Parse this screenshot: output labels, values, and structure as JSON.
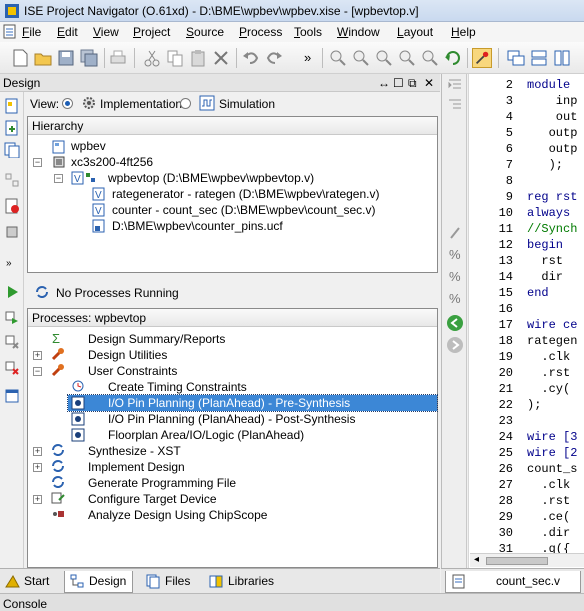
{
  "window": {
    "title": "ISE Project Navigator (O.61xd) - D:\\BME\\wpbev\\wpbev.xise - [wpbevtop.v]"
  },
  "menu": [
    {
      "label": "File",
      "u": "F"
    },
    {
      "label": "Edit",
      "u": "E"
    },
    {
      "label": "View",
      "u": "V"
    },
    {
      "label": "Project",
      "u": "P"
    },
    {
      "label": "Source",
      "u": "S"
    },
    {
      "label": "Process",
      "u": "P"
    },
    {
      "label": "Tools",
      "u": "T"
    },
    {
      "label": "Window",
      "u": "W"
    },
    {
      "label": "Layout",
      "u": "L"
    },
    {
      "label": "Help",
      "u": "H"
    }
  ],
  "design": {
    "panel_title": "Design",
    "view_label": "View:",
    "view_options": [
      "Implementation",
      "Simulation"
    ],
    "view_selected": "Implementation",
    "hierarchy_title": "Hierarchy",
    "hierarchy": [
      {
        "label": "wpbev"
      },
      {
        "label": "xc3s200-4ft256"
      },
      {
        "label": "wpbevtop (D:\\BME\\wpbev\\wpbevtop.v)"
      },
      {
        "label": "rategenerator - rategen (D:\\BME\\wpbev\\rategen.v)"
      },
      {
        "label": "counter - count_sec (D:\\BME\\wpbev\\count_sec.v)"
      },
      {
        "label": "D:\\BME\\wpbev\\counter_pins.ucf"
      }
    ],
    "process_status": "No Processes Running",
    "processes_title": "Processes: wpbevtop",
    "processes": [
      {
        "label": "Design Summary/Reports"
      },
      {
        "label": "Design Utilities"
      },
      {
        "label": "User Constraints"
      },
      {
        "label": "Create Timing Constraints"
      },
      {
        "label": "I/O Pin Planning (PlanAhead) - Pre-Synthesis"
      },
      {
        "label": "I/O Pin Planning (PlanAhead) - Post-Synthesis"
      },
      {
        "label": "Floorplan Area/IO/Logic (PlanAhead)"
      },
      {
        "label": "Synthesize - XST"
      },
      {
        "label": "Implement Design"
      },
      {
        "label": "Generate Programming File"
      },
      {
        "label": "Configure Target Device"
      },
      {
        "label": "Analyze Design Using ChipScope"
      }
    ],
    "selected_process": "I/O Pin Planning (PlanAhead) - Pre-Synthesis"
  },
  "tabs": [
    "Start",
    "Design",
    "Files",
    "Libraries"
  ],
  "active_tab": "Design",
  "editor": {
    "tab_label": "count_sec.v",
    "lines": [
      {
        "n": "2",
        "t": "module "
      },
      {
        "n": "3",
        "t": "    inp"
      },
      {
        "n": "4",
        "t": "    out"
      },
      {
        "n": "5",
        "t": "   outp"
      },
      {
        "n": "6",
        "t": "   outp"
      },
      {
        "n": "7",
        "t": "   );"
      },
      {
        "n": "8",
        "t": ""
      },
      {
        "n": "9",
        "t": "reg rst"
      },
      {
        "n": "10",
        "t": "always "
      },
      {
        "n": "11",
        "t": "//Synch"
      },
      {
        "n": "12",
        "t": "begin "
      },
      {
        "n": "13",
        "t": "  rst "
      },
      {
        "n": "14",
        "t": "  dir "
      },
      {
        "n": "15",
        "t": "end"
      },
      {
        "n": "16",
        "t": ""
      },
      {
        "n": "17",
        "t": "wire ce"
      },
      {
        "n": "18",
        "t": "rategen"
      },
      {
        "n": "19",
        "t": "  .clk"
      },
      {
        "n": "20",
        "t": "  .rst"
      },
      {
        "n": "21",
        "t": "  .cy("
      },
      {
        "n": "22",
        "t": ");"
      },
      {
        "n": "23",
        "t": ""
      },
      {
        "n": "24",
        "t": "wire [3"
      },
      {
        "n": "25",
        "t": "wire [2"
      },
      {
        "n": "26",
        "t": "count_s"
      },
      {
        "n": "27",
        "t": "  .clk"
      },
      {
        "n": "28",
        "t": "  .rst"
      },
      {
        "n": "29",
        "t": "  .ce("
      },
      {
        "n": "30",
        "t": "  .dir"
      },
      {
        "n": "31",
        "t": "  .q({"
      }
    ]
  },
  "console_label": "Console"
}
